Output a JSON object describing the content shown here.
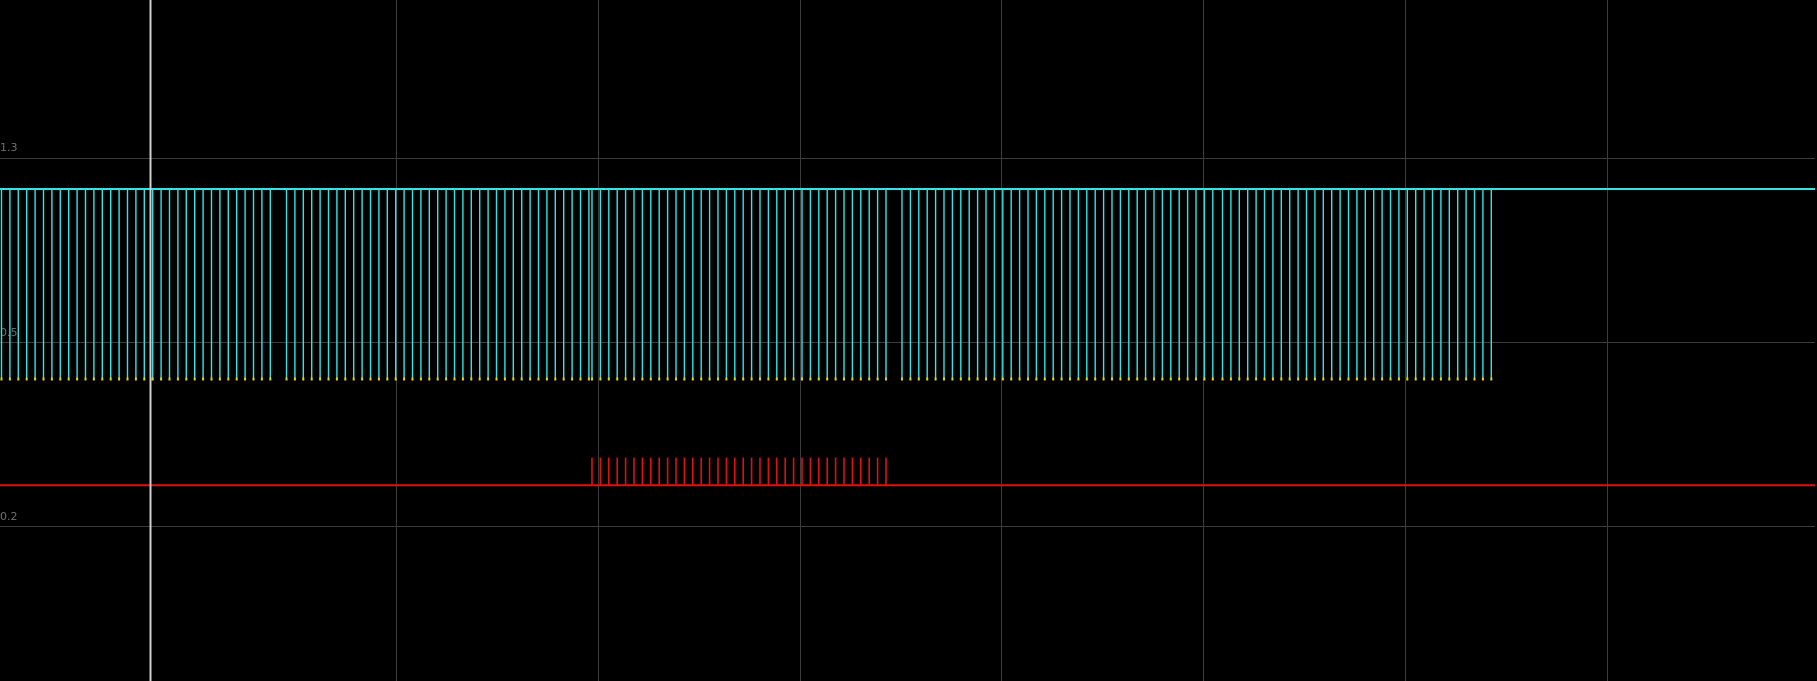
{
  "chart_data": {
    "type": "line",
    "title": "",
    "xlabel": "",
    "ylabel": "",
    "grid": true,
    "y_ticks": [
      "1.3",
      "0.5",
      "0.2"
    ],
    "cursor_time": 150.5,
    "series": [
      {
        "color": "#2ee6e6",
        "style": "pulse-train",
        "high": 1.03,
        "low": 0.0,
        "bursts": [
          {
            "start": 1.5,
            "period": 8.4,
            "count": 33
          },
          {
            "start": 286.5,
            "period": 8.4,
            "count": 37
          },
          {
            "start": 592,
            "period": 8.4,
            "count": 36
          },
          {
            "start": 902,
            "period": 8.4,
            "count": 38
          },
          {
            "start": 1222.5,
            "period": 8.4,
            "count": 33
          }
        ]
      },
      {
        "color": "#e01010",
        "style": "spike-train",
        "baseline": -0.58,
        "peak": -0.43,
        "bursts": [
          {
            "start": 592,
            "period": 8.4,
            "count": 36
          }
        ]
      }
    ],
    "markers": {
      "color": "#e8d800",
      "position": "pulse-low"
    }
  },
  "colors": {
    "background": "#000000",
    "grid": "#3c3c3c",
    "cursor": "#d0d0d0"
  }
}
